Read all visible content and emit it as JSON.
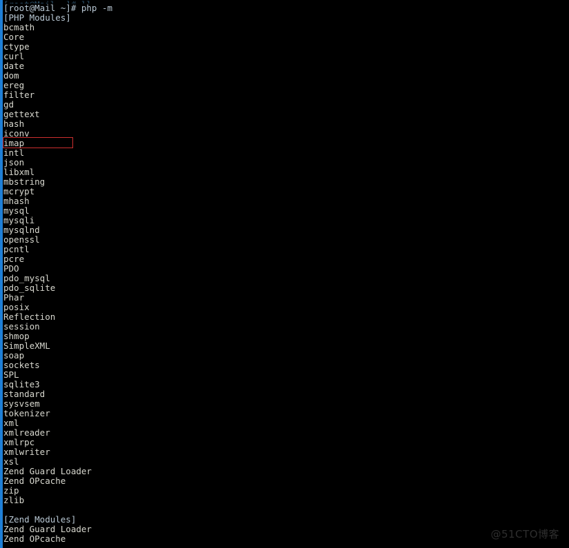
{
  "terminal": {
    "colors": {
      "background": "#000000",
      "text": "#d8d8cf",
      "prompt_text": "#b9c8d4",
      "left_stripe": "#1f7fd6",
      "highlight_border": "#cc2f2f",
      "watermark": "#2e2e2e"
    },
    "scrollback_remnant": "[root@Mail ~]# ll",
    "prompt_line": "[root@Mail ~]# php -m",
    "php_modules_header": "[PHP Modules]",
    "php_modules": [
      "bcmath",
      "Core",
      "ctype",
      "curl",
      "date",
      "dom",
      "ereg",
      "filter",
      "gd",
      "gettext",
      "hash",
      "iconv",
      "imap",
      "intl",
      "json",
      "libxml",
      "mbstring",
      "mcrypt",
      "mhash",
      "mysql",
      "mysqli",
      "mysqlnd",
      "openssl",
      "pcntl",
      "pcre",
      "PDO",
      "pdo_mysql",
      "pdo_sqlite",
      "Phar",
      "posix",
      "Reflection",
      "session",
      "shmop",
      "SimpleXML",
      "soap",
      "sockets",
      "SPL",
      "sqlite3",
      "standard",
      "sysvsem",
      "tokenizer",
      "xml",
      "xmlreader",
      "xmlrpc",
      "xmlwriter",
      "xsl",
      "Zend Guard Loader",
      "Zend OPcache",
      "zip",
      "zlib"
    ],
    "zend_modules_header": "[Zend Modules]",
    "zend_modules": [
      "Zend Guard Loader",
      "Zend OPcache"
    ],
    "highlighted_module": "imap",
    "watermark": "@51CTO博客"
  }
}
